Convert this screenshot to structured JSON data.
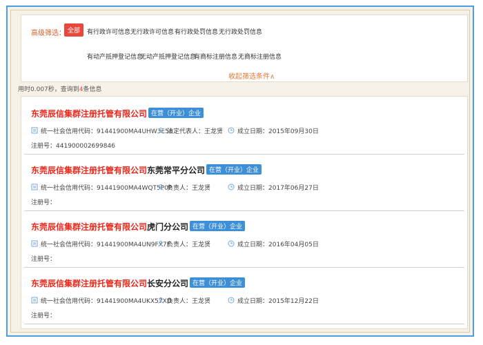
{
  "filters": {
    "label": "高级筛选：",
    "active": "全部",
    "row1": [
      "有行政许可信息",
      "无行政许可信息",
      "有行政处罚信息",
      "无行政处罚信息"
    ],
    "row2": [
      "有动产抵押登记信息",
      "无动产抵押登记信息",
      "有商标注册信息",
      "无商标注册信息"
    ],
    "collapse": "收起筛选条件∧"
  },
  "stats": {
    "prefix": "用时0.007秒，查询到",
    "count": "4",
    "suffix": "条信息"
  },
  "labels": {
    "credit_code": "统一社会信用代码：",
    "legal_rep": "法定代表人：",
    "manager": "负责人：",
    "established": "成立日期：",
    "reg_no": "注册号："
  },
  "results": [
    {
      "name_highlight": "东莞辰信集群注册托管有限公司",
      "name_rest": "",
      "status": "在营（开业）企业",
      "credit_code": "91441900MA4UHW3E58",
      "person_label": "法定代表人：",
      "person": "王龙贤",
      "established": "2015年09月30日",
      "reg_no": "441900002699846"
    },
    {
      "name_highlight": "东莞辰信集群注册托管有限公司",
      "name_rest": "东莞常平分公司",
      "status": "在营（开业）企业",
      "credit_code": "91441900MA4WQT5P0P",
      "person_label": "负责人：",
      "person": "王龙贤",
      "established": "2017年06月27日",
      "reg_no": ""
    },
    {
      "name_highlight": "东莞辰信集群注册托管有限公司",
      "name_rest": "虎门分公司",
      "status": "在营（开业）企业",
      "credit_code": "91441900MA4UN9FX7F",
      "person_label": "负责人：",
      "person": "王龙贤",
      "established": "2016年04月05日",
      "reg_no": ""
    },
    {
      "name_highlight": "东莞辰信集群注册托管有限公司",
      "name_rest": "长安分公司",
      "status": "在营（开业）企业",
      "credit_code": "91441900MA4UKX57XD",
      "person_label": "负责人：",
      "person": "王龙贤",
      "established": "2015年12月22日",
      "reg_no": ""
    }
  ]
}
